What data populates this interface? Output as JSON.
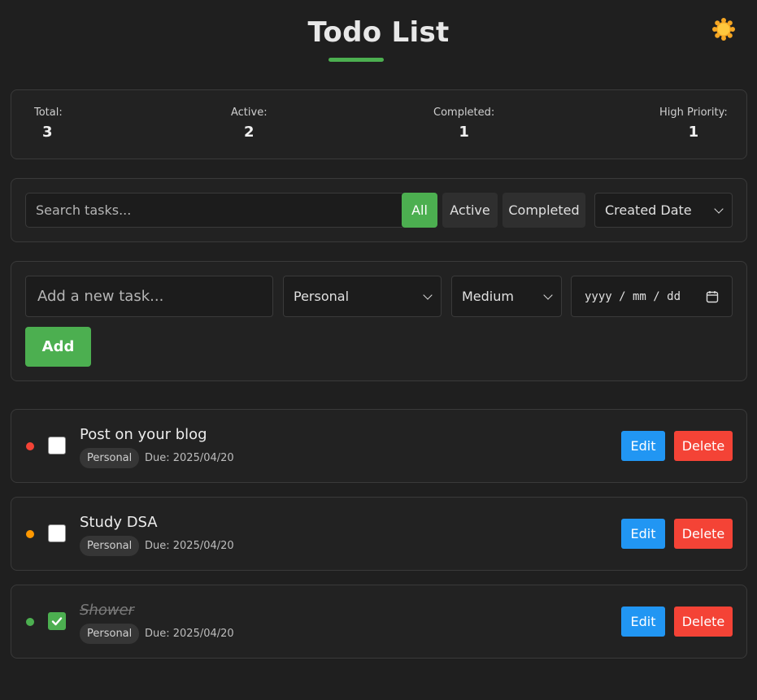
{
  "header": {
    "title": "Todo List",
    "theme_icon": "sun-icon"
  },
  "stats": [
    {
      "label": "Total:",
      "value": "3"
    },
    {
      "label": "Active:",
      "value": "2"
    },
    {
      "label": "Completed:",
      "value": "1"
    },
    {
      "label": "High Priority:",
      "value": "1"
    }
  ],
  "filters": {
    "search_placeholder": "Search tasks...",
    "buttons": [
      "All",
      "Active",
      "Completed"
    ],
    "active_filter": "All",
    "sort_selected": "Created Date"
  },
  "add_form": {
    "task_placeholder": "Add a new task...",
    "category_selected": "Personal",
    "priority_selected": "Medium",
    "date_placeholder": "yyyy / mm / dd",
    "add_label": "Add"
  },
  "tasks": [
    {
      "title": "Post on your blog",
      "category": "Personal",
      "due": "Due: 2025/04/20",
      "priority_color": "#f44336",
      "completed": false
    },
    {
      "title": "Study DSA",
      "category": "Personal",
      "due": "Due: 2025/04/20",
      "priority_color": "#ff9800",
      "completed": false
    },
    {
      "title": "Shower",
      "category": "Personal",
      "due": "Due: 2025/04/20",
      "priority_color": "#4caf50",
      "completed": true
    }
  ],
  "task_actions": {
    "edit": "Edit",
    "delete": "Delete"
  },
  "colors": {
    "accent": "#4caf50",
    "edit": "#2196f3",
    "delete": "#f44336",
    "background": "#1f1f1f"
  }
}
